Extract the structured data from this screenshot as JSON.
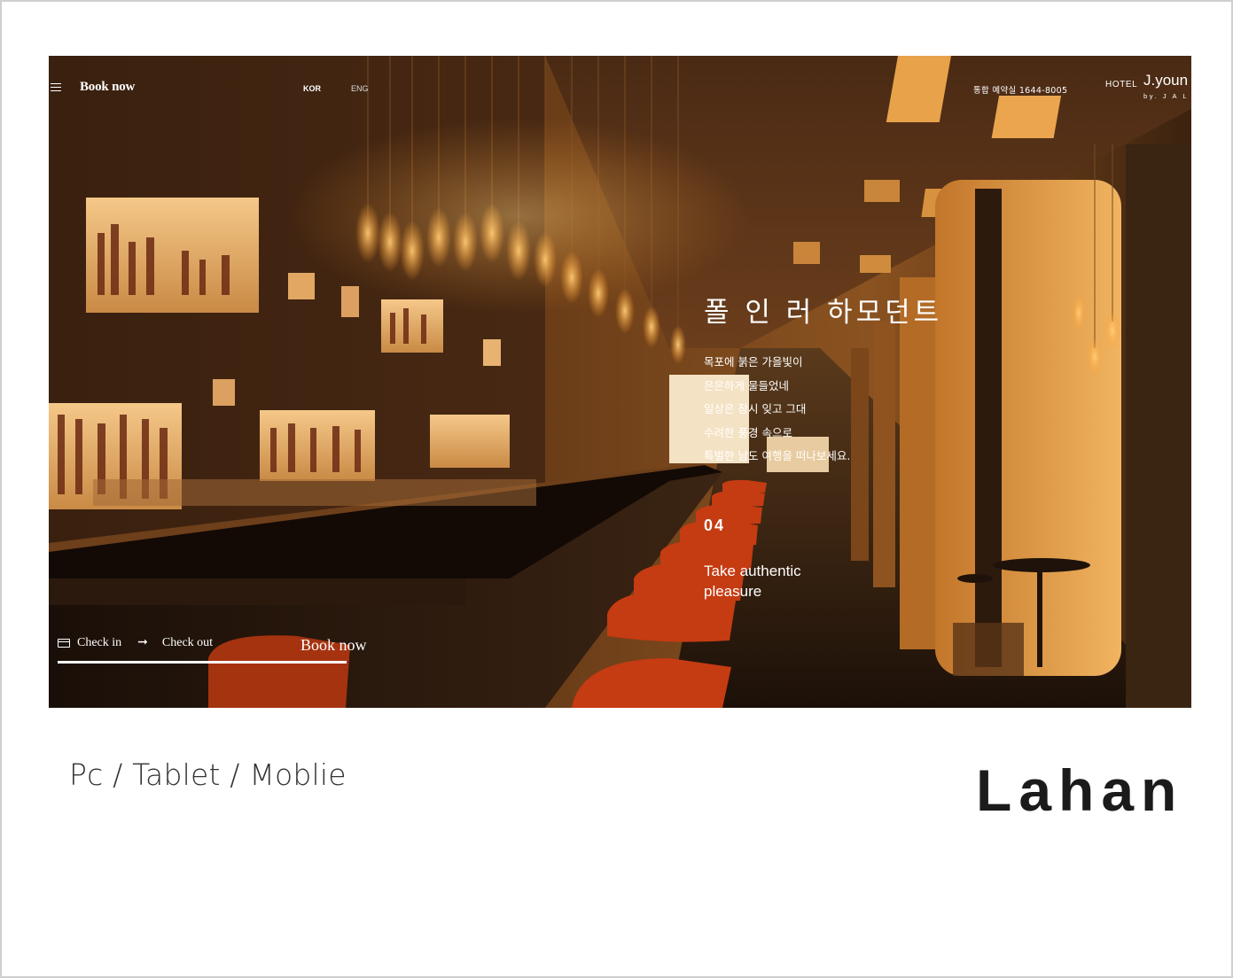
{
  "colors": {
    "accent": "#ffffff",
    "background": "#ffffff",
    "caption": "#333333",
    "title": "#1b1b1b"
  },
  "topbar": {
    "menu_icon": "hamburger-icon",
    "book_label": "Book now",
    "lang_kor": "KOR",
    "lang_eng": "ENG",
    "phone": "통합 예약실 1644-8005",
    "hotel_label": "HOTEL",
    "brand_name": "J.youn",
    "brand_sub": "by. J A L N A"
  },
  "slide": {
    "headline": "폴 인 러 하모던트",
    "poem": [
      "목포에 붉은 가을빛이",
      "은은하게 물들었네",
      "일상은 잠시 잊고 그대",
      "수려한 풍경 속으로",
      "특별한 남도 여행을 떠나보세요."
    ],
    "number": "04",
    "tagline": "Take authentic pleasure"
  },
  "booking": {
    "checkin_icon": "card-icon",
    "checkin_label": "Check in",
    "arrow_icon": "arrow-right-icon",
    "checkout_label": "Check out",
    "book_label": "Book now"
  },
  "caption": {
    "platforms": "Pc / Tablet / Moblie",
    "project": "Lahan"
  }
}
